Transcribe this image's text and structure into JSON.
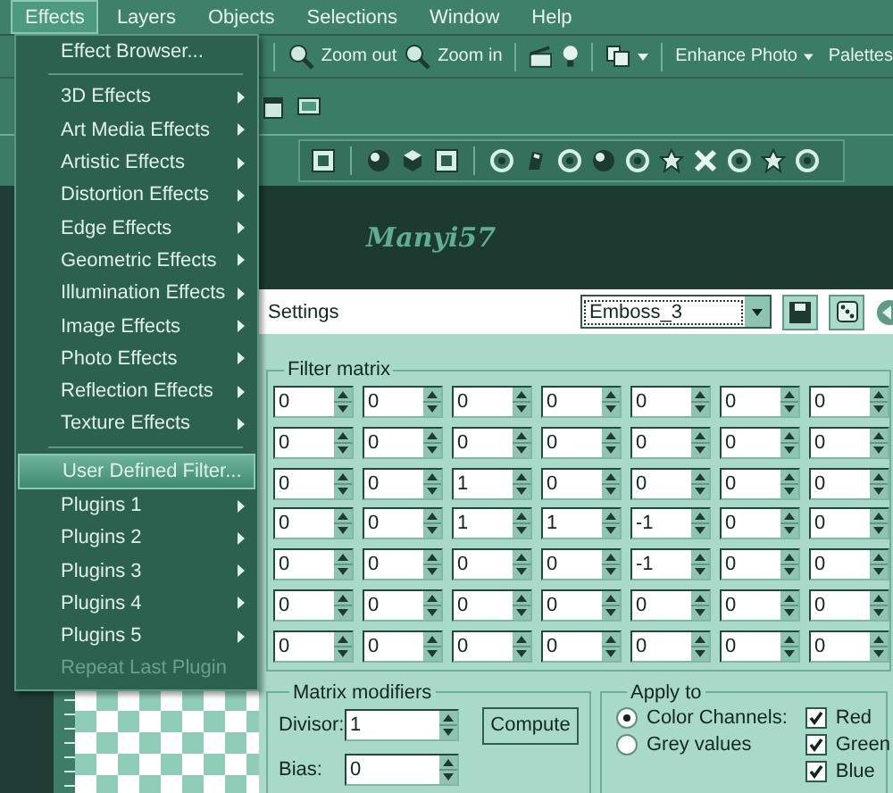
{
  "menubar": [
    {
      "label": "Effects",
      "selected": true
    },
    {
      "label": "Layers",
      "selected": false
    },
    {
      "label": "Objects",
      "selected": false
    },
    {
      "label": "Selections",
      "selected": false
    },
    {
      "label": "Window",
      "selected": false
    },
    {
      "label": "Help",
      "selected": false
    }
  ],
  "toolbar": {
    "zoom_out": "Zoom out",
    "zoom_in": "Zoom in",
    "enhance_photo": "Enhance Photo",
    "palettes": "Palettes"
  },
  "banner": {
    "text": "Manyi57"
  },
  "menu": {
    "items": [
      {
        "kind": "item",
        "label": "Effect Browser...",
        "submenu": false,
        "selected": false,
        "disabled": false
      },
      {
        "kind": "separator"
      },
      {
        "kind": "item",
        "label": "3D Effects",
        "submenu": true,
        "selected": false,
        "disabled": false
      },
      {
        "kind": "item",
        "label": "Art Media Effects",
        "submenu": true,
        "selected": false,
        "disabled": false
      },
      {
        "kind": "item",
        "label": "Artistic Effects",
        "submenu": true,
        "selected": false,
        "disabled": false
      },
      {
        "kind": "item",
        "label": "Distortion Effects",
        "submenu": true,
        "selected": false,
        "disabled": false
      },
      {
        "kind": "item",
        "label": "Edge Effects",
        "submenu": true,
        "selected": false,
        "disabled": false
      },
      {
        "kind": "item",
        "label": "Geometric Effects",
        "submenu": true,
        "selected": false,
        "disabled": false
      },
      {
        "kind": "item",
        "label": "Illumination Effects",
        "submenu": true,
        "selected": false,
        "disabled": false
      },
      {
        "kind": "item",
        "label": "Image Effects",
        "submenu": true,
        "selected": false,
        "disabled": false
      },
      {
        "kind": "item",
        "label": "Photo Effects",
        "submenu": true,
        "selected": false,
        "disabled": false
      },
      {
        "kind": "item",
        "label": "Reflection Effects",
        "submenu": true,
        "selected": false,
        "disabled": false
      },
      {
        "kind": "item",
        "label": "Texture Effects",
        "submenu": true,
        "selected": false,
        "disabled": false
      },
      {
        "kind": "separator"
      },
      {
        "kind": "item",
        "label": "User Defined Filter...",
        "submenu": false,
        "selected": true,
        "disabled": false
      },
      {
        "kind": "item",
        "label": "Plugins 1",
        "submenu": true,
        "selected": false,
        "disabled": false
      },
      {
        "kind": "item",
        "label": "Plugins 2",
        "submenu": true,
        "selected": false,
        "disabled": false
      },
      {
        "kind": "item",
        "label": "Plugins 3",
        "submenu": true,
        "selected": false,
        "disabled": false
      },
      {
        "kind": "item",
        "label": "Plugins 4",
        "submenu": true,
        "selected": false,
        "disabled": false
      },
      {
        "kind": "item",
        "label": "Plugins 5",
        "submenu": true,
        "selected": false,
        "disabled": false
      },
      {
        "kind": "item",
        "label": "Repeat Last Plugin",
        "submenu": false,
        "selected": false,
        "disabled": true
      }
    ]
  },
  "dialog": {
    "settings_label": "Settings",
    "preset": "Emboss_3",
    "filter_matrix": {
      "title": "Filter matrix",
      "rows": [
        [
          "0",
          "0",
          "0",
          "0",
          "0",
          "0",
          "0"
        ],
        [
          "0",
          "0",
          "0",
          "0",
          "0",
          "0",
          "0"
        ],
        [
          "0",
          "0",
          "1",
          "0",
          "0",
          "0",
          "0"
        ],
        [
          "0",
          "0",
          "1",
          "1",
          "-1",
          "0",
          "0"
        ],
        [
          "0",
          "0",
          "0",
          "0",
          "-1",
          "0",
          "0"
        ],
        [
          "0",
          "0",
          "0",
          "0",
          "0",
          "0",
          "0"
        ],
        [
          "0",
          "0",
          "0",
          "0",
          "0",
          "0",
          "0"
        ]
      ]
    },
    "matrix_modifiers": {
      "title": "Matrix modifiers",
      "divisor_label": "Divisor:",
      "divisor": "1",
      "bias_label": "Bias:",
      "bias": "0",
      "compute": "Compute"
    },
    "apply_to": {
      "title": "Apply to",
      "options": [
        {
          "label": "Color Channels:",
          "selected": true
        },
        {
          "label": "Grey values",
          "selected": false
        }
      ],
      "channels": [
        {
          "label": "Red",
          "checked": true
        },
        {
          "label": "Green",
          "checked": true
        },
        {
          "label": "Blue",
          "checked": true
        }
      ]
    }
  }
}
